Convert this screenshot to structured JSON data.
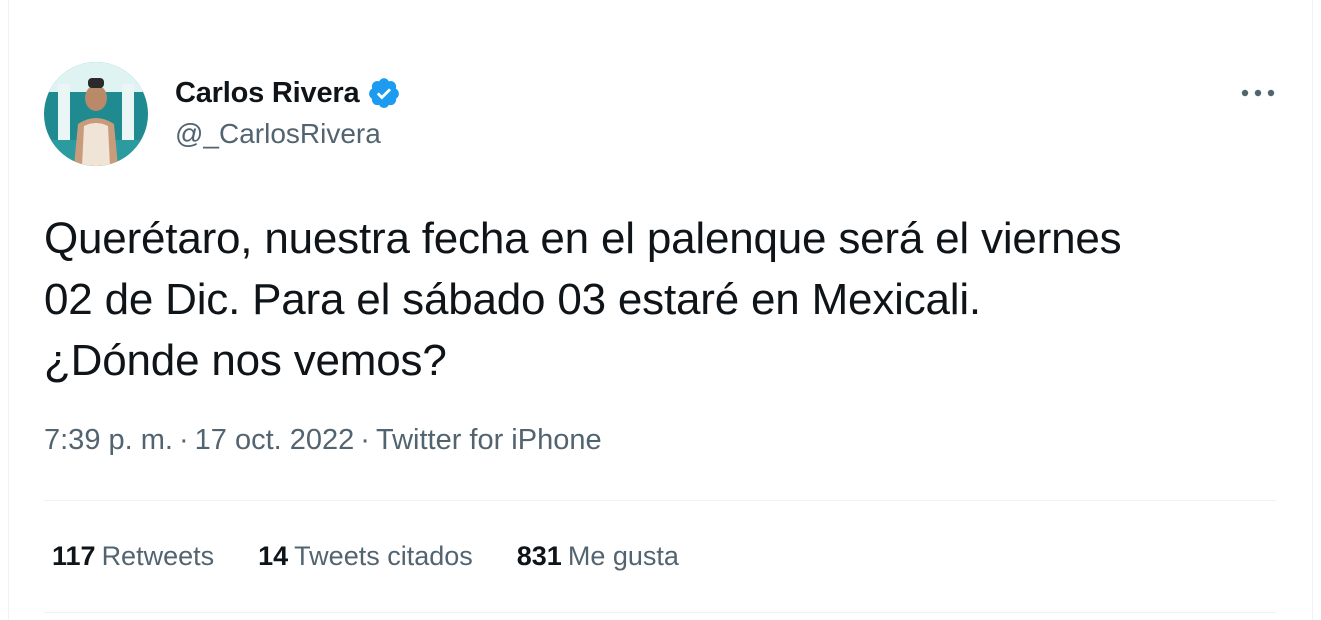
{
  "author": {
    "display_name": "Carlos Rivera",
    "handle": "@_CarlosRivera",
    "verified": true,
    "verified_color": "#1d9bf0"
  },
  "tweet": {
    "lines": [
      "Querétaro, nuestra fecha en el palenque será el viernes",
      "02 de Dic. Para el sábado 03 estaré en Mexicali.",
      "¿Dónde nos vemos?"
    ]
  },
  "meta": {
    "time": "7:39 p. m.",
    "date": "17 oct. 2022",
    "separator": "·",
    "source": "Twitter for iPhone"
  },
  "stats": [
    {
      "count": "117",
      "label": "Retweets"
    },
    {
      "count": "14",
      "label": "Tweets citados"
    },
    {
      "count": "831",
      "label": "Me gusta"
    }
  ],
  "icons": {
    "more": "more-icon",
    "verified": "verified-badge-icon"
  },
  "colors": {
    "text": "#0f1419",
    "secondary": "#536471",
    "border": "#eff3f4",
    "accent": "#1d9bf0"
  }
}
